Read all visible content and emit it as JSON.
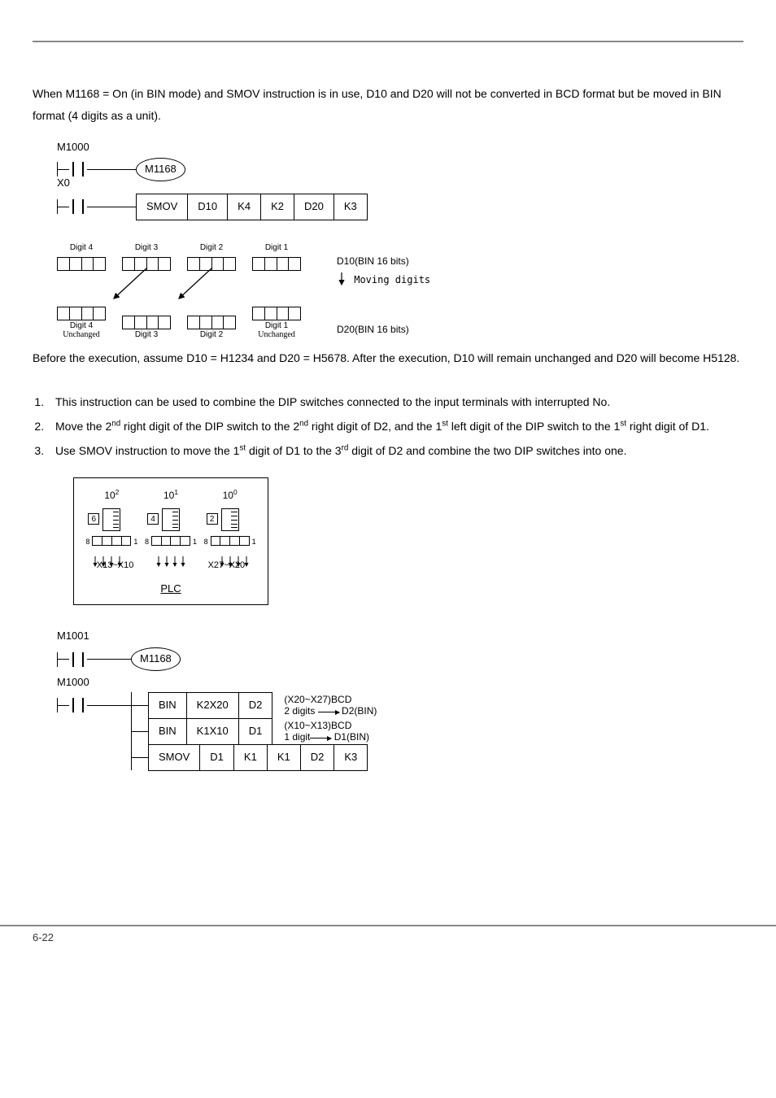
{
  "intro_para": "When M1168 = On (in BIN mode) and SMOV instruction is in use, D10 and D20 will not be converted in BCD format but be moved in BIN format (4 digits as a unit).",
  "ladder1": {
    "r1_label": "M1000",
    "r1_coil": "M1168",
    "r2_label": "X0",
    "r2_instr": [
      "SMOV",
      "D10",
      "K4",
      "K2",
      "D20",
      "K3"
    ],
    "digits": [
      "Digit 4",
      "Digit 3",
      "Digit 2",
      "Digit 1"
    ],
    "unchanged": "Unchanged",
    "side_top": "D10(BIN 16 bits)",
    "side_mid": "Moving digits",
    "side_bot": "D20(BIN 16 bits)"
  },
  "mid_para": "Before the execution, assume D10 = H1234 and D20 = H5678. After the execution, D10 will remain unchanged and D20 will become H5128.",
  "steps": {
    "s1": "This instruction can be used to combine the DIP switches connected to the input terminals with interrupted No.",
    "s2a": "Move the 2",
    "s2b": " right digit of the DIP switch to the 2",
    "s2c": " right digit of D2, and the 1",
    "s2d": " left digit of the DIP switch to the 1",
    "s2e": " right digit of D1.",
    "s3a": "Use SMOV instruction to move the 1",
    "s3b": " digit of D1 to the 3",
    "s3c": " digit of D2 and combine the two DIP switches into one.",
    "nd": "nd",
    "st": "st",
    "rd": "rd"
  },
  "dip": {
    "pow2": "2",
    "pow1": "1",
    "pow0": "0",
    "d6": "6",
    "d4": "4",
    "d2": "2",
    "n8": "8",
    "n1": "1",
    "x13": "X13~X10",
    "x27": "X27~X20",
    "plc": "PLC"
  },
  "ladder2": {
    "r1_label": "M1001",
    "r1_coil": "M1168",
    "r2_label": "M1000",
    "row_a": [
      "BIN",
      "K2X20",
      "D2"
    ],
    "row_b": [
      "BIN",
      "K1X10",
      "D1"
    ],
    "row_c": [
      "SMOV",
      "D1",
      "K1",
      "K1",
      "D2",
      "K3"
    ],
    "ca1": "(X20~X27)BCD",
    "ca2a": "2 digits ",
    "ca2b": " D2(BIN)",
    "cb1": "(X10~X13)BCD",
    "cb2a": "1 digit",
    "cb2b": " D1(BIN)"
  },
  "page_num": "6-22"
}
